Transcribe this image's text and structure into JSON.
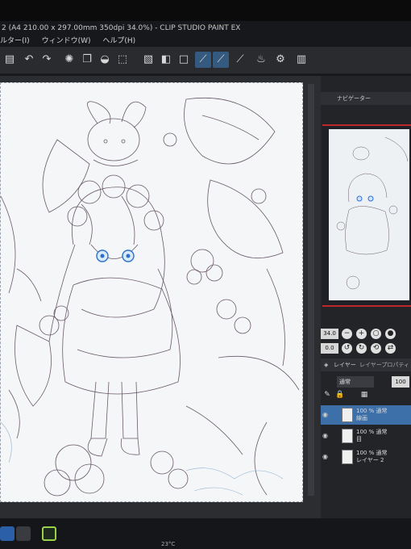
{
  "window": {
    "title": "2 (A4 210.00 x 297.00mm 350dpi 34.0%) - CLIP STUDIO PAINT EX"
  },
  "menu": {
    "items": [
      "ルター(I)",
      "ウィンドウ(W)",
      "ヘルプ(H)"
    ]
  },
  "toolbar": {
    "icons": [
      "new-file-icon",
      "undo-icon",
      "redo-icon",
      "loading-icon",
      "copy-icon",
      "fill-icon",
      "transform-icon",
      "hide-icon",
      "fill-adjust-icon",
      "square-icon",
      "pen-icon",
      "pen2-icon",
      "pen3-icon",
      "cup-icon",
      "settings-icon",
      "book-icon"
    ]
  },
  "navigator": {
    "title": "ナビゲーター"
  },
  "view_controls": {
    "zoom": "34.0",
    "rotation": "0.0"
  },
  "layer_panel": {
    "tab_layers": "レイヤー",
    "tab_property": "レイヤープロパティ",
    "blend_mode": "通常",
    "opacity": "100",
    "layers": [
      {
        "line1": "100 % 通常",
        "line2": "線画",
        "selected": true
      },
      {
        "line1": "100 % 通常",
        "line2": "目",
        "selected": false
      },
      {
        "line1": "100 % 通常",
        "line2": "レイヤー 2",
        "selected": false
      }
    ]
  },
  "taskbar": {
    "tray_text": "23°C"
  }
}
